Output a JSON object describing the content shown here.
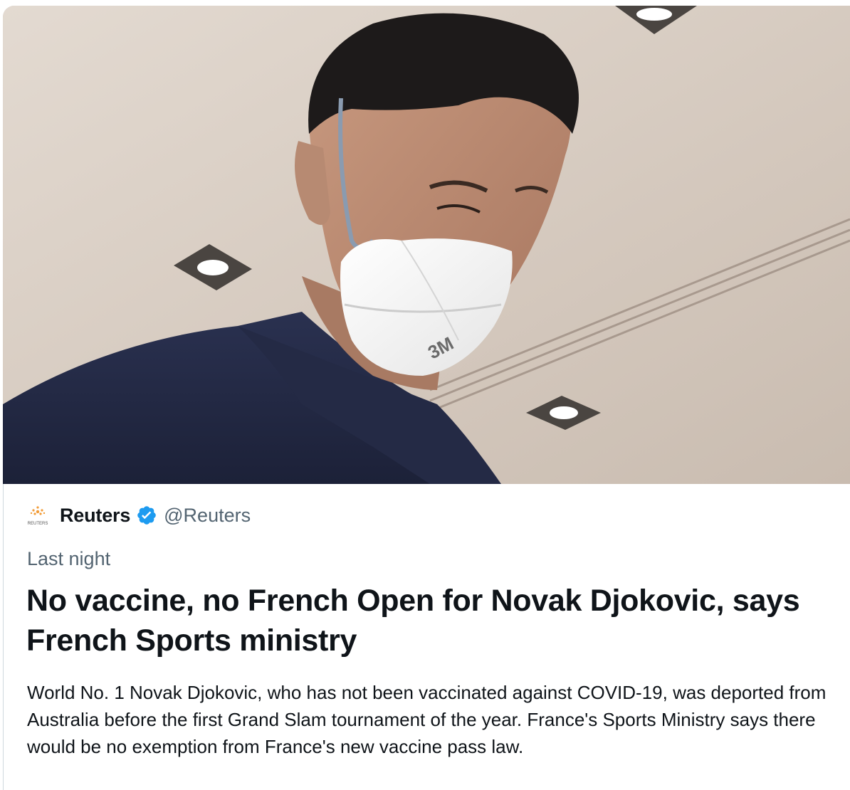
{
  "tweet": {
    "image_alt": "Novak Djokovic wearing a 3M face mask",
    "mask_brand": "3M",
    "author": {
      "name": "Reuters",
      "handle": "@Reuters",
      "verified": true,
      "avatar_text": "REUTERS",
      "avatar_icon": "reuters-logo-icon"
    },
    "timestamp": "Last night",
    "headline": "No vaccine, no French Open for Novak Djokovic, says French Sports ministry",
    "summary": "World No. 1 Novak Djokovic, who has not been vaccinated against COVID-19, was deported from Australia before the first Grand Slam tournament of the year. France's Sports Ministry says there would be no exemption from France's new vaccine pass law."
  },
  "colors": {
    "text_primary": "#0f1419",
    "text_secondary": "#536471",
    "verified_blue": "#1d9bf0",
    "border": "#cfd9de"
  }
}
